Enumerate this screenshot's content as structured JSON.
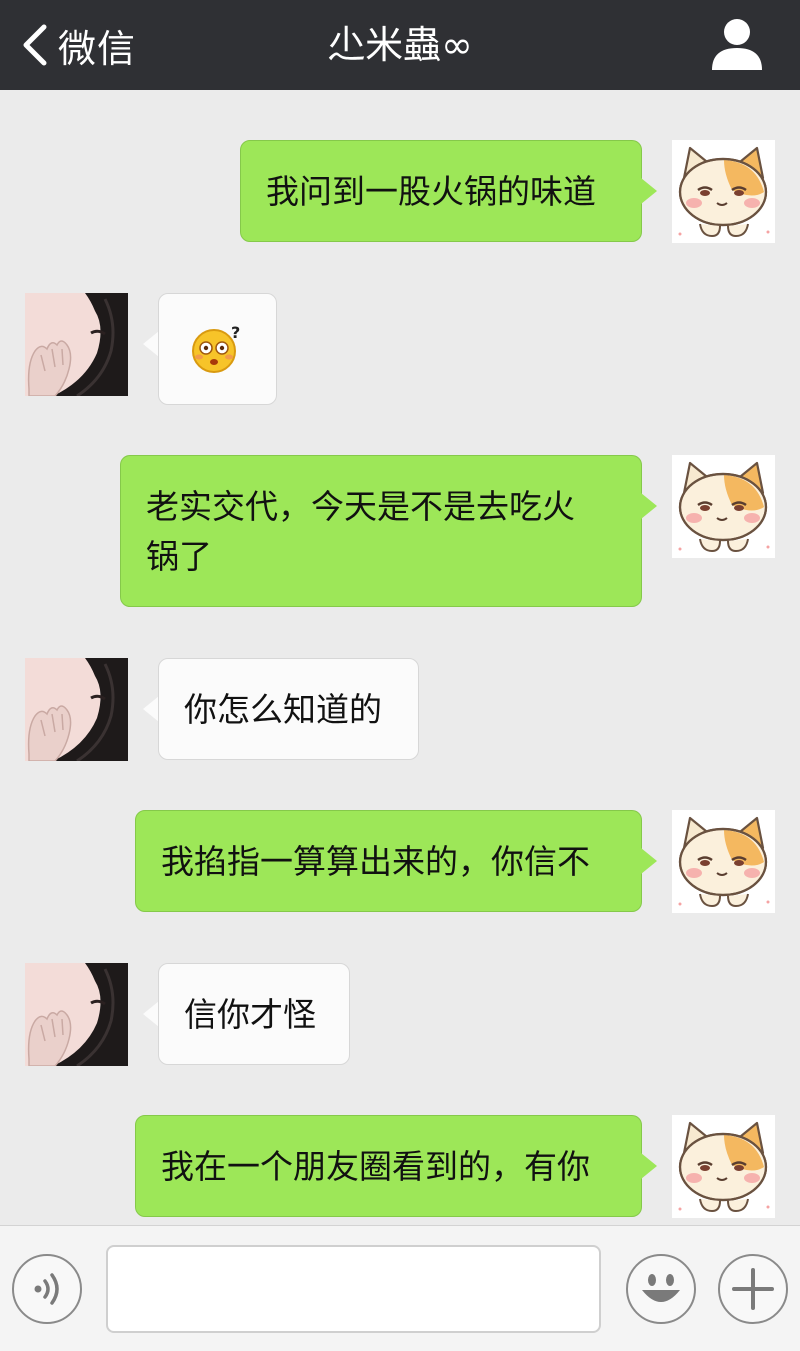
{
  "header": {
    "back_label": "微信",
    "title": "尐米蟲∞",
    "background": "#2f3034"
  },
  "messages": [
    {
      "sender": "me",
      "text": "我问到一股火锅的味道",
      "bubble_color": "#9de758"
    },
    {
      "sender": "them",
      "emoji": "confused-face-emoji"
    },
    {
      "sender": "me",
      "lines": [
        "老实交代，今天是不是去吃火",
        "锅了"
      ],
      "bubble_color": "#9de758"
    },
    {
      "sender": "them",
      "text": "你怎么知道的"
    },
    {
      "sender": "me",
      "text": "我掐指一算算出来的，你信不"
    },
    {
      "sender": "them",
      "text": "信你才怪"
    },
    {
      "sender": "me",
      "text": "我在一个朋友圈看到的，有你"
    }
  ],
  "input_bar": {
    "voice_icon": "voice-icon",
    "text_value": "",
    "emoji_icon": "smiley-icon",
    "plus_icon": "plus-icon"
  },
  "colors": {
    "chat_background": "#ebebeb",
    "my_bubble": "#9de758",
    "their_bubble": "#fbfbfb"
  }
}
